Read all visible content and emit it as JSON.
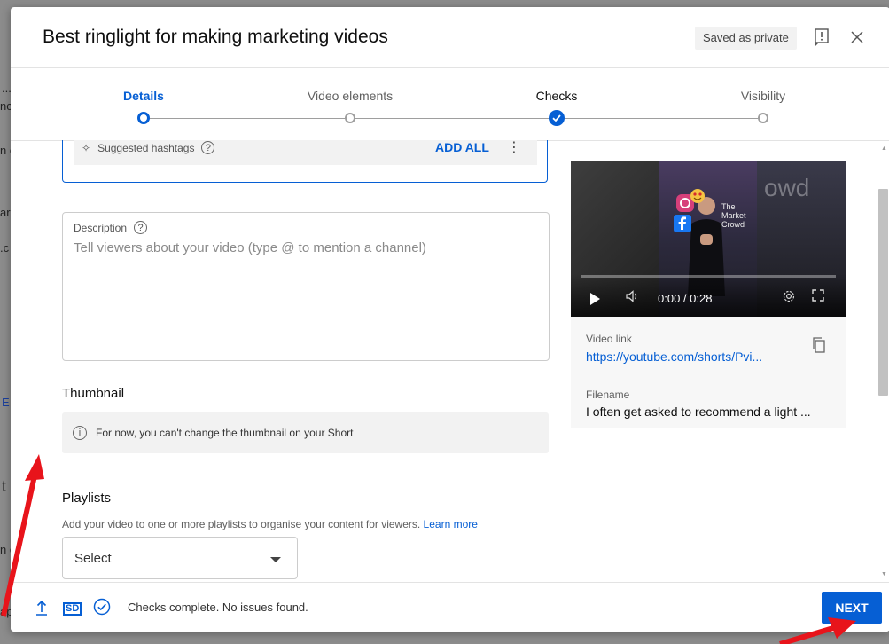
{
  "background_page": {
    "fragments": [
      "...",
      "nc",
      "n c",
      "ar",
      ".c",
      "E",
      "t",
      "n c",
      "ap"
    ]
  },
  "modal": {
    "title": "Best ringlight for making marketing videos",
    "saved_badge": "Saved as private",
    "feedback_icon": "feedback-icon",
    "close_icon": "close-icon"
  },
  "stepper": {
    "steps": [
      {
        "label": "Details",
        "state": "active"
      },
      {
        "label": "Video elements",
        "state": "inactive"
      },
      {
        "label": "Checks",
        "state": "done"
      },
      {
        "label": "Visibility",
        "state": "inactive"
      }
    ]
  },
  "tags": {
    "suggested_label": "Suggested hashtags",
    "help": "?",
    "add_all": "ADD ALL",
    "menu": "⋮"
  },
  "description": {
    "label": "Description",
    "help": "?",
    "placeholder": "Tell viewers about your video (type @ to mention a channel)"
  },
  "thumbnail": {
    "title": "Thumbnail",
    "info_icon": "i",
    "note": "For now, you can't change the thumbnail on your Short"
  },
  "playlists": {
    "title": "Playlists",
    "desc": "Add your video to one or more playlists to organise your content for viewers.",
    "learn_more": "Learn more",
    "select_value": "Select"
  },
  "video": {
    "time": "0:00 / 0:28",
    "watermark": "owd",
    "watermark_small": "The Market Crowd",
    "link_label": "Video link",
    "link": "https://youtube.com/shorts/Pvi...",
    "filename_label": "Filename",
    "filename": "I often get asked to recommend a light ..."
  },
  "footer": {
    "sd": "SD",
    "status": "Checks complete. No issues found.",
    "next": "NEXT"
  },
  "colors": {
    "accent": "#065fd4",
    "annotation": "#e8141b"
  }
}
